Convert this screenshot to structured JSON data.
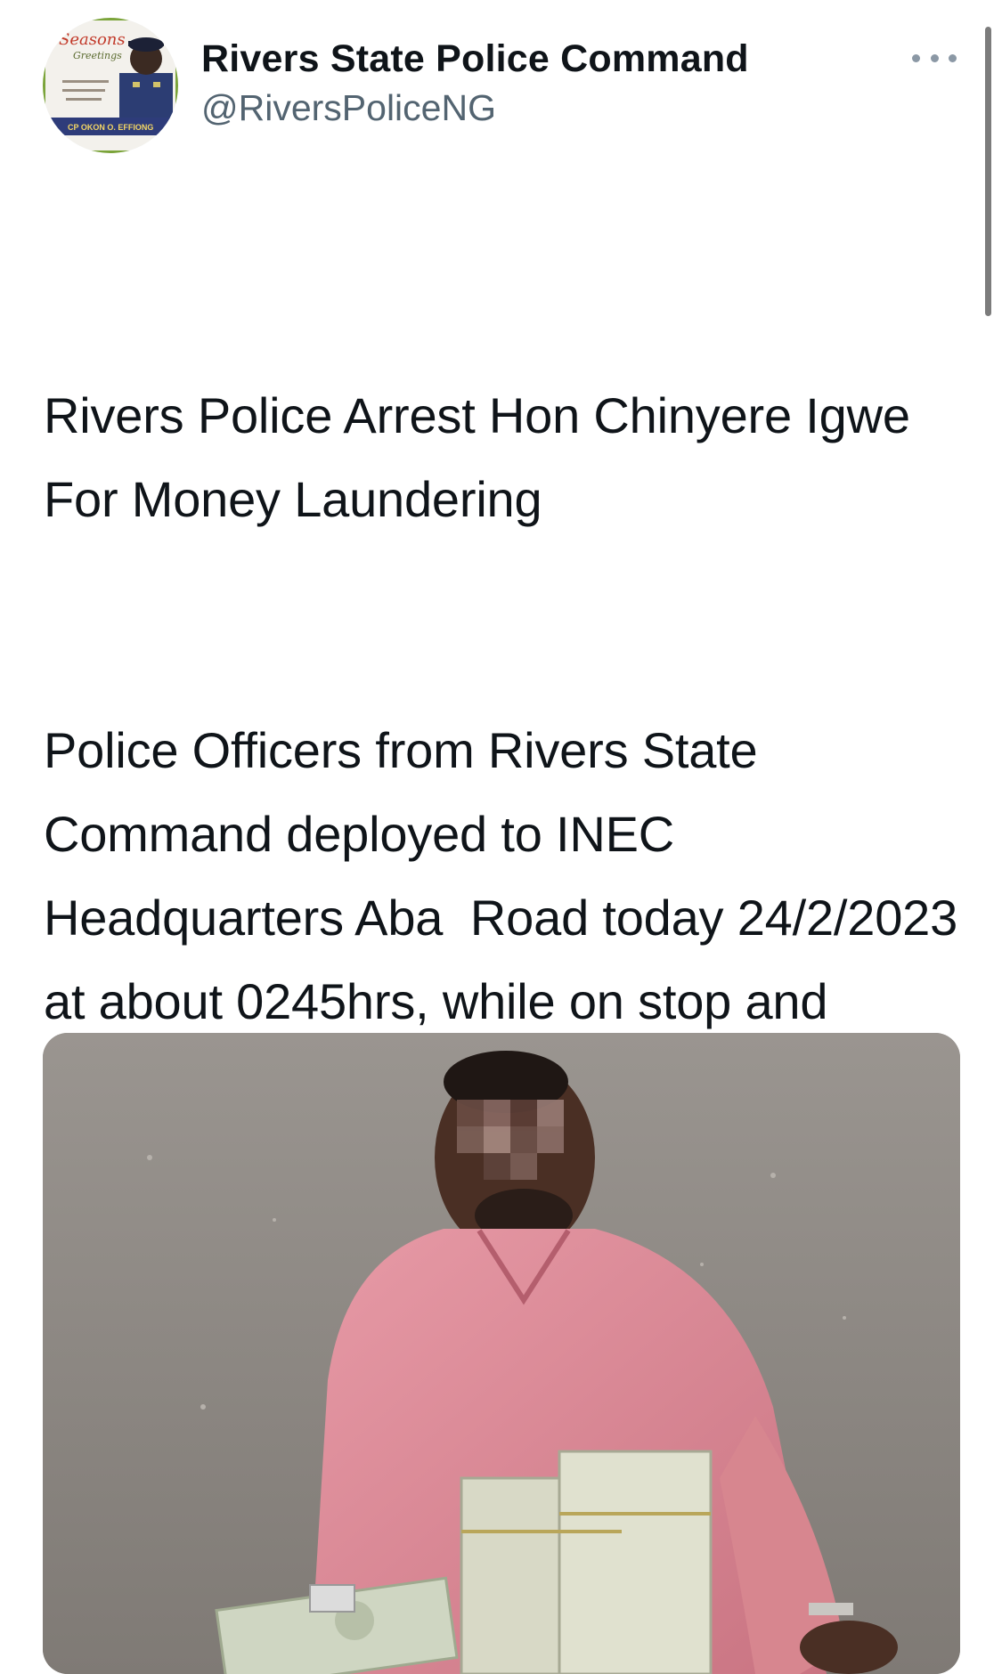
{
  "author": {
    "display_name": "Rivers State Police Command",
    "handle": "@RiversPoliceNG",
    "avatar": {
      "icon": "avatar-police-commissioner",
      "banner_text": "Seasons",
      "banner_subtext": "Greetings",
      "caption": "CP OKON O. EFFIONG"
    }
  },
  "header": {
    "more_icon": "ellipsis-icon"
  },
  "tweet": {
    "headline": "Rivers Police Arrest Hon Chinyere Igwe For Money Laundering",
    "body": "Police Officers from Rivers State Command deployed to INEC Headquarters Aba  Road today 24/2/2023 at about 0245hrs, while on stop and search, arrested one Hon Chinyere Igwe, member House of Representatives representing"
  },
  "media": {
    "kind": "photo",
    "icon": "photo-man-with-cash"
  },
  "colors": {
    "text": "#0f1419",
    "secondary": "#536471",
    "background": "#ffffff"
  }
}
